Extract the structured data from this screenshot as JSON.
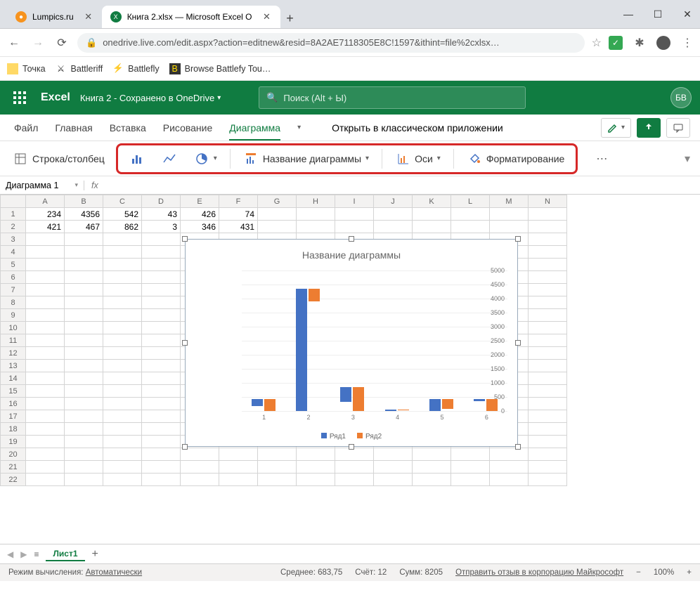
{
  "browser": {
    "tabs": [
      {
        "title": "Lumpics.ru",
        "favicon_color": "#f7931e"
      },
      {
        "title": "Книга 2.xlsx — Microsoft Excel O",
        "favicon_color": "#107c41"
      }
    ],
    "url": "onedrive.live.com/edit.aspx?action=editnew&resid=8A2AE7118305E8C!1597&ithint=file%2cxlsx…",
    "bookmarks": [
      "Точка",
      "Battleriff",
      "Battlefly",
      "Browse Battlefy Tou…"
    ]
  },
  "excel": {
    "app_name": "Excel",
    "doc_title": "Книга 2 - Сохранено в OneDrive",
    "search_placeholder": "Поиск (Alt + Ы)",
    "avatar": "БВ",
    "ribbon_tabs": [
      "Файл",
      "Главная",
      "Вставка",
      "Рисование",
      "Диаграмма"
    ],
    "open_desktop": "Открыть в классическом приложении",
    "tools": {
      "row_col": "Строка/столбец",
      "chart_title": "Название диаграммы",
      "axes": "Оси",
      "formatting": "Форматирование"
    },
    "name_box": "Диаграмма 1",
    "fx_label": "fx",
    "columns": [
      "A",
      "B",
      "C",
      "D",
      "E",
      "F",
      "G",
      "H",
      "I",
      "J",
      "K",
      "L",
      "M",
      "N"
    ],
    "rows": 22,
    "cell_data": {
      "1": [
        234,
        4356,
        542,
        43,
        426,
        74
      ],
      "2": [
        421,
        467,
        862,
        3,
        346,
        431
      ]
    },
    "sheets": {
      "active": "Лист1"
    },
    "status": {
      "calc_mode_label": "Режим вычисления:",
      "calc_mode_value": "Автоматически",
      "avg_label": "Среднее:",
      "avg_value": "683,75",
      "count_label": "Счёт:",
      "count_value": "12",
      "sum_label": "Сумм:",
      "sum_value": "8205",
      "feedback": "Отправить отзыв в корпорацию Майкрософт",
      "zoom": "100%"
    }
  },
  "chart_data": {
    "type": "bar",
    "title": "Название диаграммы",
    "categories": [
      "1",
      "2",
      "3",
      "4",
      "5",
      "6"
    ],
    "series": [
      {
        "name": "Ряд1",
        "values": [
          234,
          4356,
          542,
          43,
          426,
          74
        ],
        "color": "#4472c4"
      },
      {
        "name": "Ряд2",
        "values": [
          421,
          467,
          862,
          3,
          346,
          431
        ],
        "color": "#ed7d31"
      }
    ],
    "ylim": [
      0,
      5000
    ],
    "yticks": [
      0,
      500,
      1000,
      1500,
      2000,
      2500,
      3000,
      3500,
      4000,
      4500,
      5000
    ]
  }
}
